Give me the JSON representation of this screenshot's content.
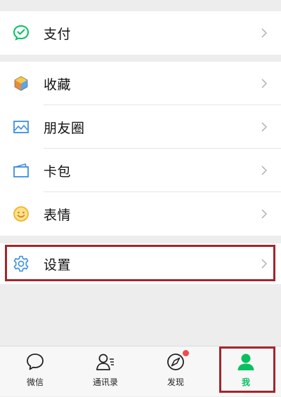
{
  "menu": {
    "pay": {
      "label": "支付",
      "icon": "wechat-pay-icon"
    },
    "favorites": {
      "label": "收藏",
      "icon": "cube-icon"
    },
    "moments": {
      "label": "朋友圈",
      "icon": "picture-icon"
    },
    "cards": {
      "label": "卡包",
      "icon": "card-wallet-icon"
    },
    "stickers": {
      "label": "表情",
      "icon": "smiley-icon"
    },
    "settings": {
      "label": "设置",
      "icon": "gear-icon"
    }
  },
  "tabbar": {
    "items": [
      {
        "label": "微信",
        "icon": "chat-bubble-icon",
        "active": false
      },
      {
        "label": "通讯录",
        "icon": "contacts-icon",
        "active": false
      },
      {
        "label": "发现",
        "icon": "compass-icon",
        "active": false,
        "badge": "dot"
      },
      {
        "label": "我",
        "icon": "person-icon",
        "active": true
      }
    ]
  },
  "colors": {
    "accent": "#07c160",
    "highlight_border": "#a3262b",
    "background": "#ededed",
    "badge": "#f04b4b"
  }
}
